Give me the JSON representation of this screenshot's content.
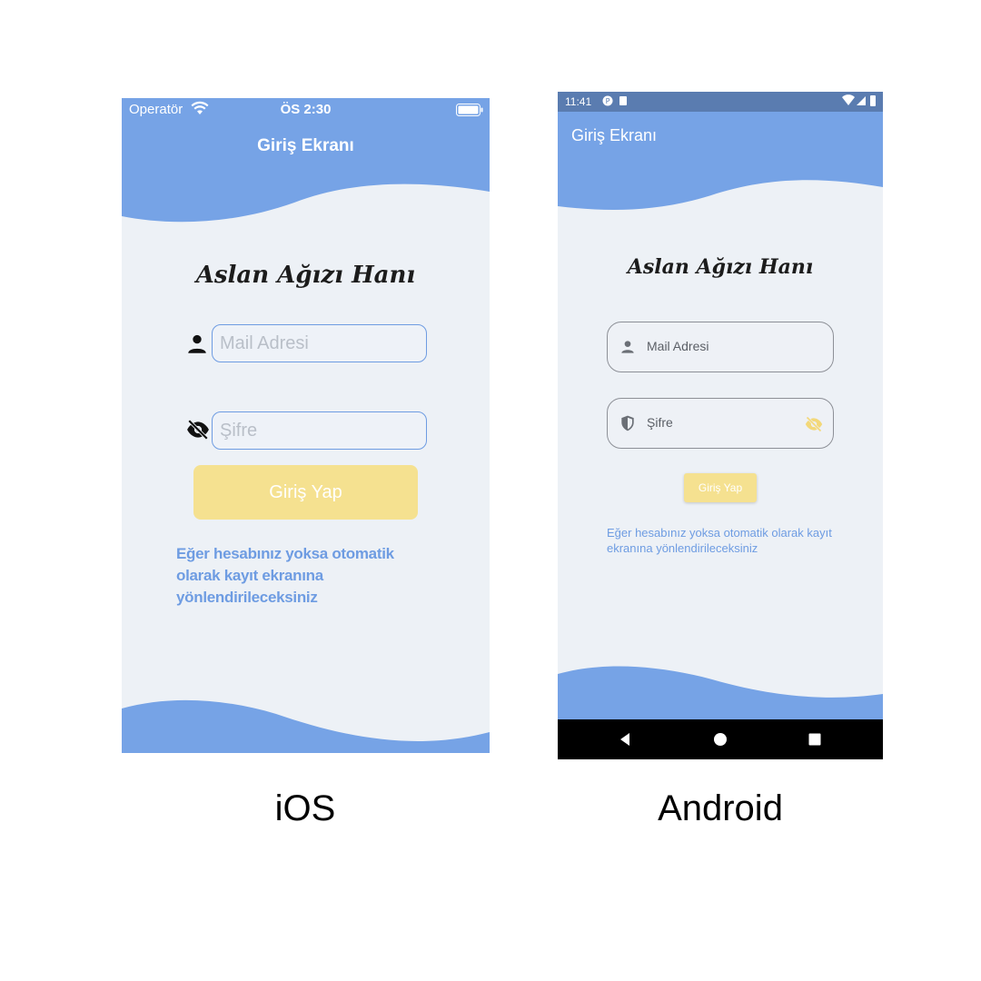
{
  "ios": {
    "status": {
      "carrier": "Operatör",
      "time": "ÖS 2:30"
    },
    "title": "Giriş Ekranı",
    "brand": "Aslan Ağızı Hanı",
    "email_placeholder": "Mail Adresi",
    "password_placeholder": "Şifre",
    "login_label": "Giriş Yap",
    "info_text": "Eğer hesabınız yoksa otomatik olarak kayıt ekranına yönlendirileceksiniz"
  },
  "android": {
    "status": {
      "time": "11:41"
    },
    "title": "Giriş Ekranı",
    "brand": "Aslan Ağızı Hanı",
    "email_label": "Mail Adresi",
    "password_label": "Şifre",
    "login_label": "Giriş Yap",
    "info_text": "Eğer hesabınız yoksa otomatik olarak kayıt ekranına yönlendirileceksiniz"
  },
  "captions": {
    "ios": "iOS",
    "android": "Android"
  },
  "colors": {
    "accent_blue": "#76a3e6",
    "background": "#edf1f6",
    "button_yellow": "#f5e190",
    "link_blue": "#6e9ce2"
  },
  "icons": [
    "wifi-icon",
    "battery-icon",
    "person-icon",
    "eye-off-icon",
    "shield-icon",
    "signal-icon",
    "back-icon",
    "home-icon",
    "recents-icon"
  ]
}
